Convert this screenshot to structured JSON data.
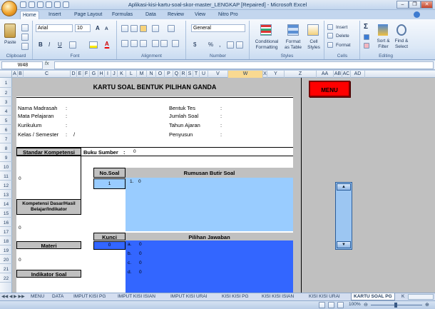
{
  "window": {
    "title": "Aplikasi-kisi-kartu-soal-skor-master_LENGKAP [Repaired] - Microsoft Excel"
  },
  "ribbon_tabs": [
    "Home",
    "Insert",
    "Page Layout",
    "Formulas",
    "Data",
    "Review",
    "View",
    "Nitro Pro"
  ],
  "ribbon": {
    "clipboard": {
      "paste": "Paste",
      "label": "Clipboard"
    },
    "font": {
      "name": "Arial",
      "size": "10",
      "label": "Font",
      "grow": "A",
      "shrink": "A",
      "bold": "B",
      "italic": "I",
      "underline": "U",
      "fill_letter": "A"
    },
    "alignment": {
      "label": "Alignment"
    },
    "number": {
      "format": "General",
      "percent": "%",
      "comma": ",",
      "currency": "$",
      "label": "Number"
    },
    "styles": {
      "conditional": "Conditional\nFormatting",
      "format_table": "Format\nas Table",
      "cell_styles": "Cell\nStyles",
      "label": "Styles"
    },
    "cells": {
      "insert": "Insert",
      "delete": "Delete",
      "format": "Format",
      "label": "Cells"
    },
    "editing": {
      "sigma": "Σ",
      "sort": "Sort &\nFilter",
      "find": "Find &\nSelect",
      "label": "Editing"
    }
  },
  "formula_bar": {
    "name_box": "W48",
    "fx": "fx",
    "value": ""
  },
  "columns": [
    "A",
    "B",
    "C",
    "D",
    "E",
    "F",
    "G",
    "H",
    "I",
    "J",
    "K",
    "L",
    "M",
    "N",
    "O",
    "P",
    "Q",
    "R",
    "S",
    "T",
    "U",
    "V",
    "W",
    "X",
    "Y",
    "Z",
    "AA",
    "AB",
    "AC",
    "AD"
  ],
  "rows": [
    "1",
    "2",
    "3",
    "4",
    "5",
    "6",
    "7",
    "8",
    "9",
    "10",
    "11",
    "12",
    "13",
    "14",
    "15",
    "16",
    "17",
    "18",
    "19",
    "20",
    "21",
    "22"
  ],
  "card": {
    "title": "KARTU SOAL BENTUK PILIHAN GANDA",
    "nama_madrasah": "Nama Madrasah",
    "mata_pelajaran": "Mata Pelajaran",
    "kurikulum": "Kurikulum",
    "kelas_semester": "Kelas / Semester",
    "colon": ":",
    "slash": "/",
    "bentuk_tes": "Bentuk Tes",
    "jumlah_soal": "Jumlah Soal",
    "tahun_ajaran": "Tahun Ajaran",
    "penyusun": "Penyusun",
    "standar_kompetensi": "Standar Kompetensi",
    "buku_sumber": "Buku Sumber",
    "buku_sumber_value": "0",
    "sk_value": "0",
    "no_soal": "No.Soal",
    "no_soal_value": "1",
    "rumusan": "Rumusan Butir Soal",
    "question_number": "1.",
    "question_text": "0",
    "kd_title": "Kompetensi Dasar/Hasil Belajar/Indikator",
    "kd_value": "0",
    "kunci": "Kunci",
    "kunci_value": "0",
    "pilihan": "Pilihan Jawaban",
    "options": [
      {
        "letter": "a.",
        "value": "0"
      },
      {
        "letter": "b.",
        "value": "0"
      },
      {
        "letter": "c.",
        "value": "0"
      },
      {
        "letter": "d.",
        "value": "0"
      }
    ],
    "materi": "Materi",
    "materi_value": "0",
    "indikator_soal": "Indikator Soal"
  },
  "menu_button": "MENU",
  "sheet_tabs": [
    "MENU",
    "DATA",
    "IMPUT KISI PG",
    "IMPUT KISI ISIAN",
    "IMPUT KISI URAI",
    "KISI KISI PG",
    "KISI KISI ISIAN",
    "KISI KISI URAI",
    "KARTU SOAL PG",
    "K"
  ],
  "active_sheet": "KARTU SOAL PG",
  "status": {
    "zoom": "100%"
  },
  "colors": {
    "gray": "#c0c0c0",
    "light_blue": "#99ccff",
    "dark_blue": "#3366ff",
    "menu_red": "#ff0000"
  }
}
